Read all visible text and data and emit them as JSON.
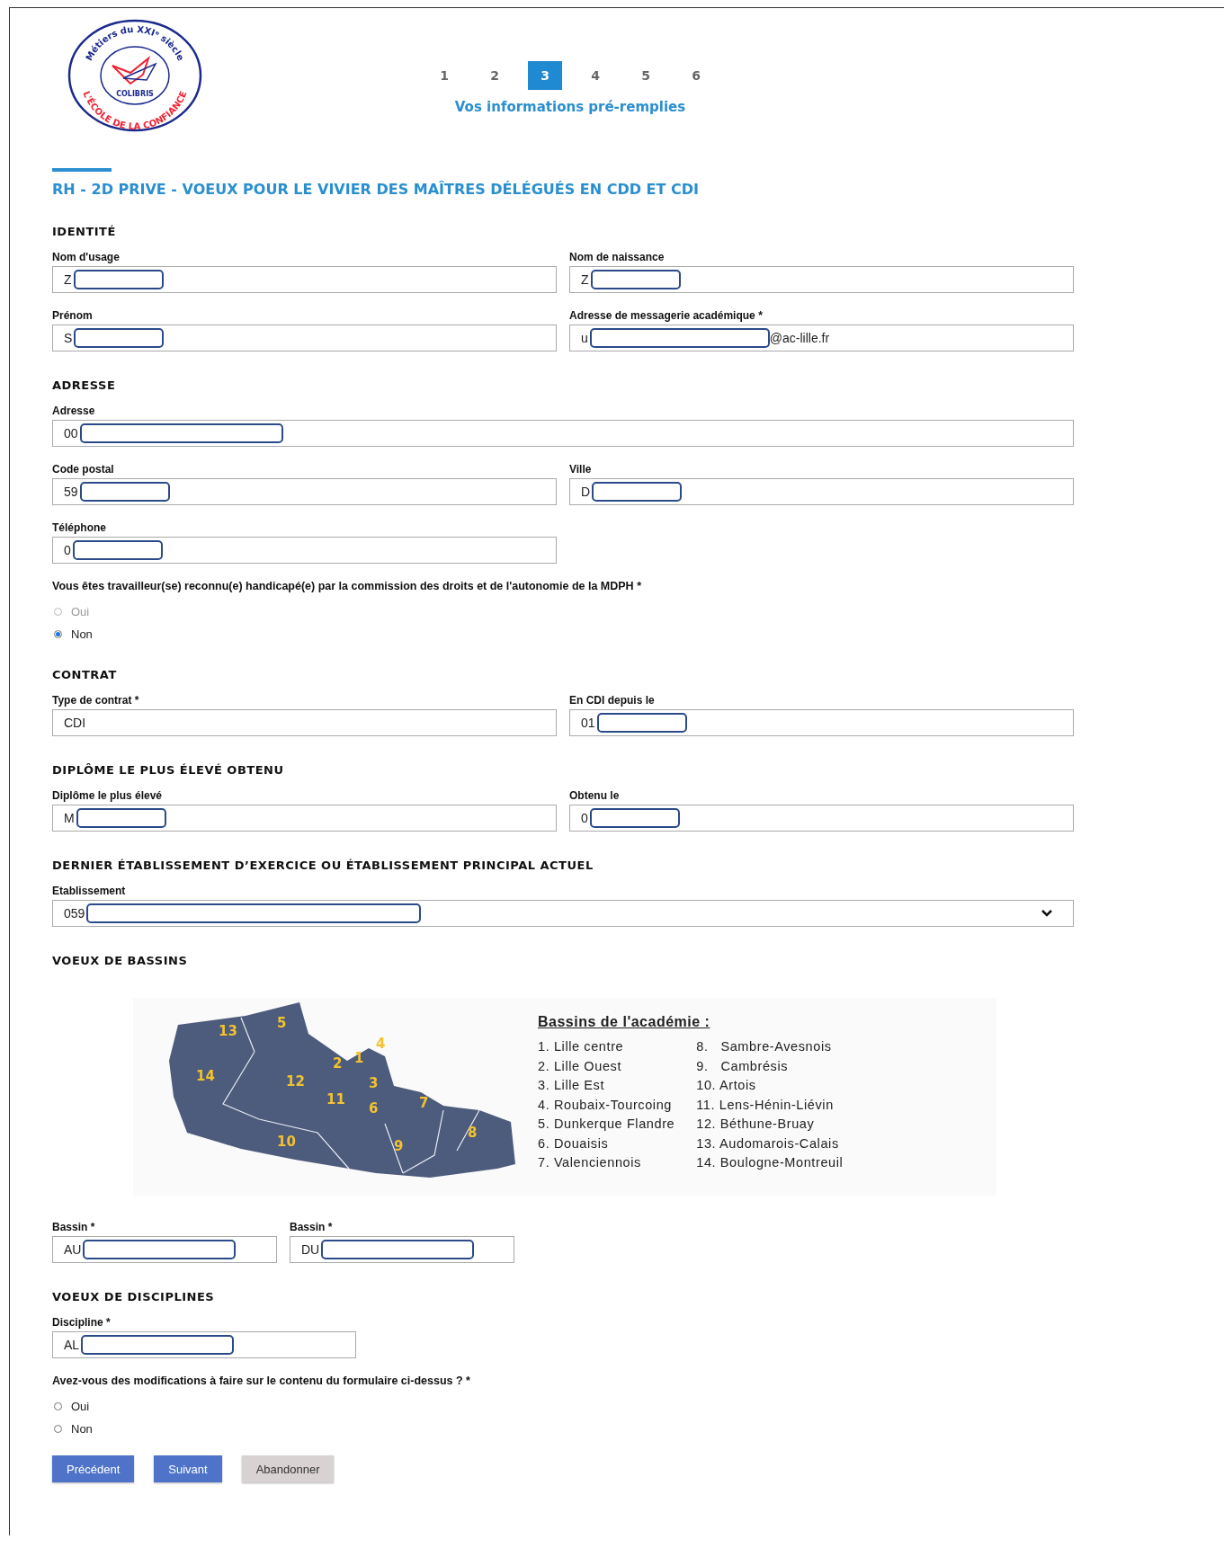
{
  "logo": {
    "top_text": "Métiers du XXIᵉ siècle",
    "center_text": "COLIBRIS",
    "bottom_text": "L'ÉCOLE DE LA CONFIANCE"
  },
  "steps": [
    {
      "label": "1",
      "selected": false
    },
    {
      "label": "2",
      "selected": false
    },
    {
      "label": "3",
      "selected": true
    },
    {
      "label": "4",
      "selected": false
    },
    {
      "label": "5",
      "selected": false
    },
    {
      "label": "6",
      "selected": false
    }
  ],
  "step_caption": "Vos informations pré-remplies",
  "form_title": "RH - 2D PRIVE - VOEUX POUR LE VIVIER DES MAÎTRES DÉLÉGUÉS EN CDD ET CDI",
  "sections": [
    {
      "heading": "IDENTITÉ",
      "blocks": [
        {
          "kind": "fields",
          "fields": [
            {
              "kind": "text",
              "label": "Nom d'usage",
              "value": "Z",
              "redacted": true
            },
            {
              "kind": "text",
              "label": "Nom de naissance",
              "value": "Z",
              "redacted": true
            }
          ]
        },
        {
          "kind": "fields",
          "fields": [
            {
              "kind": "text",
              "label": "Prénom",
              "value": "S",
              "redacted": true
            },
            {
              "kind": "text",
              "label": "Adresse de messagerie académique",
              "required_mark": "*",
              "value": "u",
              "redacted": true,
              "suffix": "@ac-lille.fr"
            }
          ]
        }
      ]
    },
    {
      "heading": "ADRESSE",
      "blocks": [
        {
          "kind": "fields",
          "fields": [
            {
              "kind": "wide-text",
              "label": "Adresse",
              "value": "00",
              "redacted": true
            }
          ]
        },
        {
          "kind": "fields",
          "fields": [
            {
              "kind": "text",
              "label": "Code postal",
              "value": "59",
              "redacted": true
            },
            {
              "kind": "text",
              "label": "Ville",
              "value": "D",
              "redacted": true
            }
          ]
        },
        {
          "kind": "fields",
          "fields": [
            {
              "kind": "text",
              "label": "Téléphone",
              "value": "0",
              "redacted": true
            }
          ]
        },
        {
          "kind": "radio",
          "question": "Vous êtes travailleur(se) reconnu(e) handicapé(e) par la commission des droits et de l'autonomie de la MDPH",
          "required_mark": "*",
          "options": [
            {
              "label": "Oui",
              "selected": false,
              "disabled": true
            },
            {
              "label": "Non",
              "selected": true,
              "disabled": false
            }
          ]
        }
      ]
    },
    {
      "heading": "CONTRAT",
      "blocks": [
        {
          "kind": "fields",
          "fields": [
            {
              "kind": "text",
              "label": "Type de contrat",
              "required_mark": "*",
              "value": "CDI"
            },
            {
              "kind": "text",
              "label": "En CDI depuis le",
              "value": "01",
              "redacted": true
            }
          ]
        }
      ]
    },
    {
      "heading": "DIPLÔME LE PLUS ÉLEVÉ OBTENU",
      "blocks": [
        {
          "kind": "fields",
          "fields": [
            {
              "kind": "text",
              "label": "Diplôme le plus élevé",
              "value": "M",
              "redacted": true
            },
            {
              "kind": "text",
              "label": "Obtenu le",
              "value": "0",
              "redacted": true
            }
          ]
        }
      ]
    },
    {
      "heading": "DERNIER ÉTABLISSEMENT D’EXERCICE OU ÉTABLISSEMENT PRINCIPAL ACTUEL",
      "blocks": [
        {
          "kind": "fields",
          "fields": [
            {
              "kind": "select",
              "label": "Etablissement",
              "value": "059",
              "redacted": true
            }
          ]
        }
      ]
    },
    {
      "heading": "VOEUX DE BASSINS",
      "blocks": [
        {
          "kind": "map",
          "title": "Bassins de l'académie :",
          "map_labels": [
            "13",
            "5",
            "14",
            "12",
            "2",
            "1",
            "4",
            "3",
            "11",
            "6",
            "7",
            "10",
            "9",
            "8"
          ],
          "legend": [
            [
              "1. Lille centre",
              "2. Lille Ouest",
              "3. Lille Est",
              "4. Roubaix-Tourcoing",
              "5. Dunkerque Flandre",
              "6. Douaisis",
              "7. Valenciennois"
            ],
            [
              "8.   Sambre-Avesnois",
              "9.   Cambrésis",
              "10. Artois",
              "11. Lens-Hénin-Liévin",
              "12. Béthune-Bruay",
              "13. Audomarois-Calais",
              "14. Boulogne-Montreuil"
            ]
          ]
        },
        {
          "kind": "fields",
          "fields": [
            {
              "kind": "short-text",
              "label": "Bassin",
              "required_mark": "*",
              "value": "AU",
              "redacted": true
            },
            {
              "kind": "short-text",
              "label": "Bassin",
              "required_mark": "*",
              "value": "DU",
              "redacted": true
            }
          ]
        }
      ]
    },
    {
      "heading": "VOEUX DE DISCIPLINES",
      "blocks": [
        {
          "kind": "fields",
          "fields": [
            {
              "kind": "medium-text",
              "label": "Discipline",
              "required_mark": "*",
              "value": "AL",
              "redacted": true
            }
          ]
        },
        {
          "kind": "radio",
          "question": "Avez-vous des modifications à faire sur le contenu du formulaire ci-dessus ?",
          "required_mark": "*",
          "options": [
            {
              "label": "Oui",
              "selected": false,
              "disabled": false
            },
            {
              "label": "Non",
              "selected": false,
              "disabled": false
            }
          ]
        }
      ]
    }
  ],
  "buttons": [
    {
      "label": "Précédent",
      "kind": "primary"
    },
    {
      "label": "Suivant",
      "kind": "primary"
    },
    {
      "label": "Abandonner",
      "kind": "secondary"
    }
  ]
}
